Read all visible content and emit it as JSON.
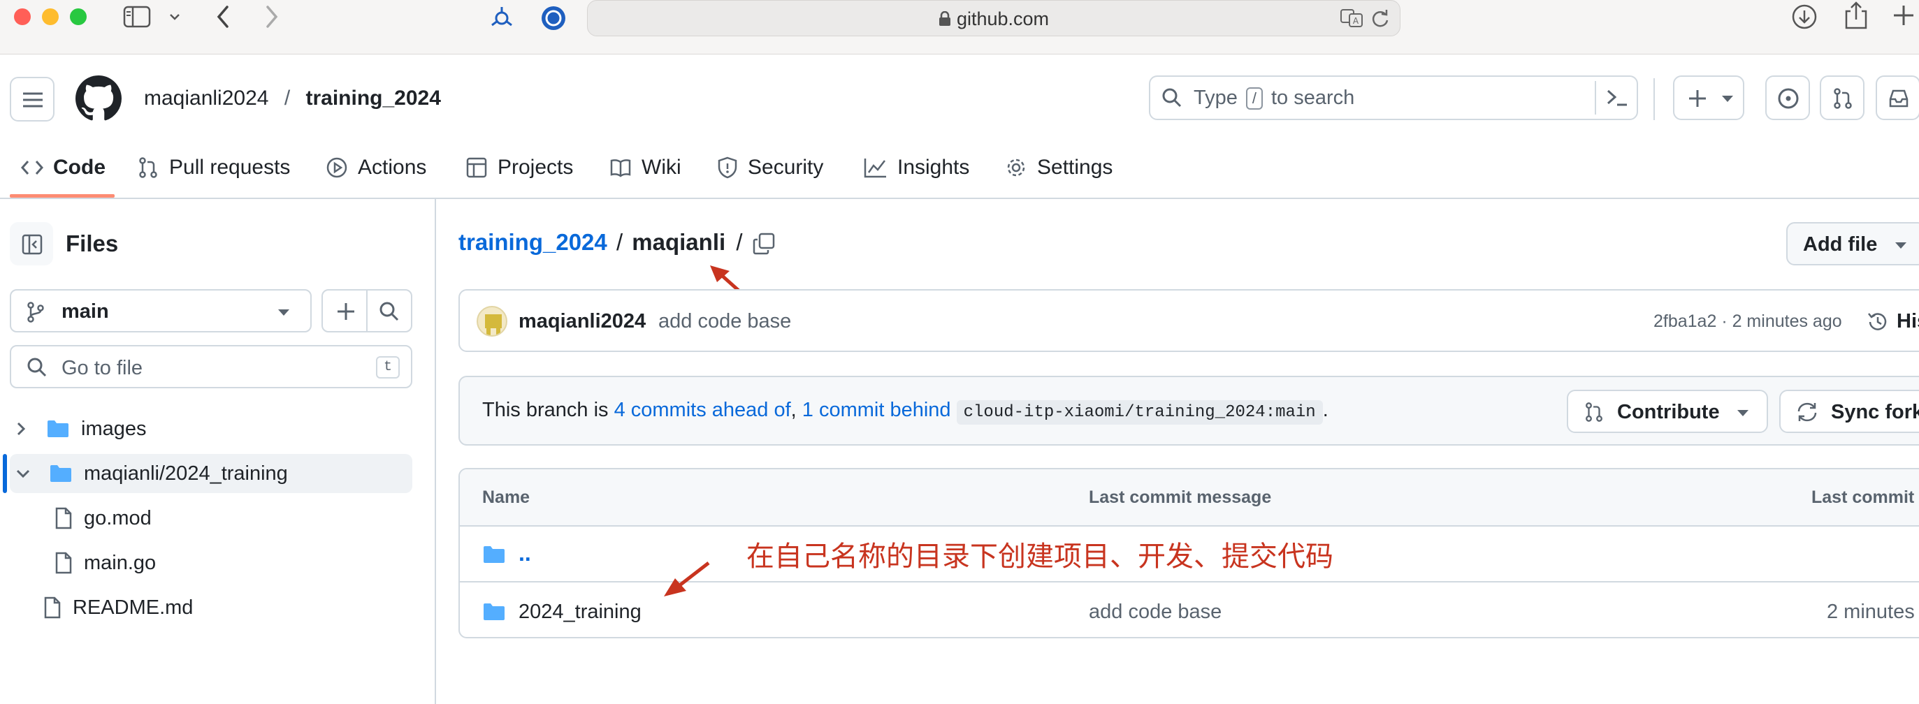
{
  "browser": {
    "url": "github.com"
  },
  "header": {
    "owner": "maqianli2024",
    "separator": "/",
    "repo": "training_2024",
    "search_prefix": "Type",
    "search_key": "/",
    "search_suffix": "to search"
  },
  "tabs": [
    {
      "label": "Code",
      "icon": "code-icon"
    },
    {
      "label": "Pull requests",
      "icon": "pull-request-icon"
    },
    {
      "label": "Actions",
      "icon": "play-icon"
    },
    {
      "label": "Projects",
      "icon": "table-icon"
    },
    {
      "label": "Wiki",
      "icon": "book-icon"
    },
    {
      "label": "Security",
      "icon": "shield-icon"
    },
    {
      "label": "Insights",
      "icon": "graph-icon"
    },
    {
      "label": "Settings",
      "icon": "gear-icon"
    }
  ],
  "sidebar": {
    "title": "Files",
    "branch": "main",
    "goto_placeholder": "Go to file",
    "goto_key": "t",
    "tree": [
      {
        "name": "images",
        "type": "folder",
        "expanded": false
      },
      {
        "name": "maqianli/2024_training",
        "type": "folder",
        "expanded": true,
        "selected": true
      },
      {
        "name": "go.mod",
        "type": "file"
      },
      {
        "name": "main.go",
        "type": "file"
      },
      {
        "name": "README.md",
        "type": "file"
      }
    ]
  },
  "main": {
    "breadcrumb_repo": "training_2024",
    "breadcrumb_sep": "/",
    "breadcrumb_dir": "maqianli",
    "breadcrumb_trail": "/",
    "add_file_label": "Add file",
    "commit": {
      "author": "maqianli2024",
      "message": "add code base",
      "sha_time": "2fba1a2 · 2 minutes ago",
      "history_label": "His"
    },
    "branch_info": {
      "prefix": "This branch is",
      "ahead": "4 commits ahead of",
      "comma": ",",
      "behind": "1 commit behind",
      "upstream": "cloud-itp-xiaomi/training_2024:main",
      "period": ".",
      "contribute_label": "Contribute",
      "sync_label": "Sync fork"
    },
    "table": {
      "col_name": "Name",
      "col_message": "Last commit message",
      "col_date": "Last commit d",
      "parent_label": "..",
      "rows": [
        {
          "name": "2024_training",
          "message": "add code base",
          "date": "2 minutes"
        }
      ]
    },
    "annotation": "在自己名称的目录下创建项目、开发、提交代码"
  },
  "colors": {
    "accent": "#0969da",
    "tab_underline": "#fd8c73",
    "folder": "#54aeff",
    "annotation_red": "#c8341f"
  }
}
